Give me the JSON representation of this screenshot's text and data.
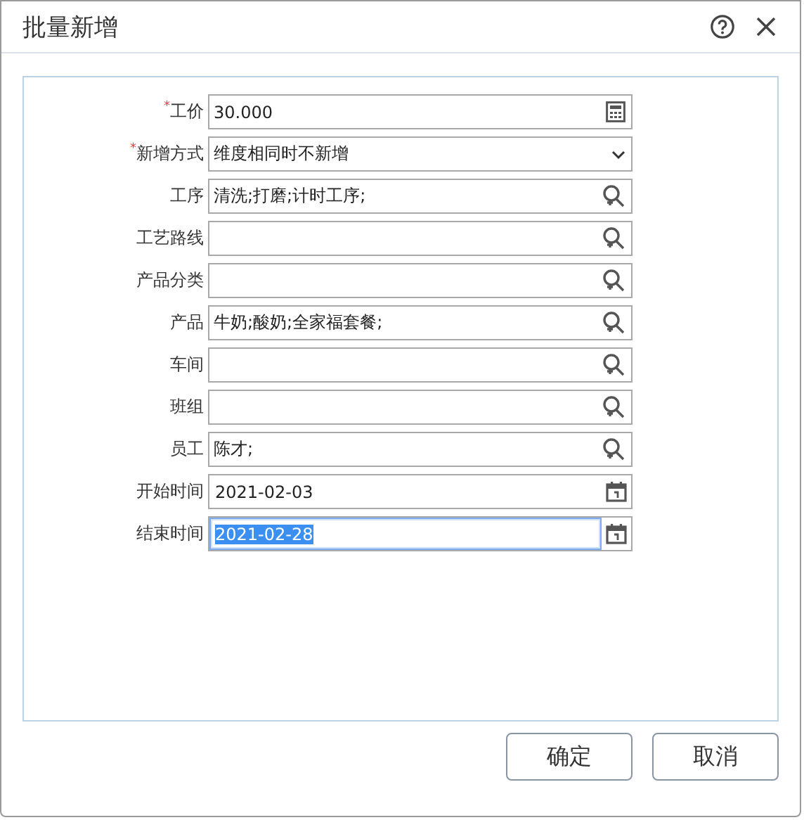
{
  "dialog": {
    "title": "批量新增"
  },
  "fields": [
    {
      "label": "工价",
      "required_mark": "*",
      "kind": "calc",
      "value": "30.000",
      "focused": false
    },
    {
      "label": "新增方式",
      "required_mark": "*",
      "kind": "select",
      "value": "维度相同时不新增",
      "focused": false
    },
    {
      "label": "工序",
      "kind": "lookup",
      "value": "清洗;打磨;计时工序;",
      "focused": false
    },
    {
      "label": "工艺路线",
      "kind": "lookup",
      "focused": false
    },
    {
      "label": "产品分类",
      "kind": "lookup",
      "focused": false
    },
    {
      "label": "产品",
      "kind": "lookup",
      "value": "牛奶;酸奶;全家福套餐;",
      "focused": false
    },
    {
      "label": "车间",
      "kind": "lookup",
      "focused": false
    },
    {
      "label": "班组",
      "kind": "lookup",
      "focused": false
    },
    {
      "label": "员工",
      "kind": "lookup",
      "value": "陈才;",
      "focused": false
    },
    {
      "label": "开始时间",
      "kind": "date",
      "value": "2021-02-03",
      "focused": false
    },
    {
      "label": "结束时间",
      "kind": "date",
      "value": "2021-02-28",
      "focused": true
    }
  ],
  "buttons": [
    "确定",
    "取消"
  ]
}
